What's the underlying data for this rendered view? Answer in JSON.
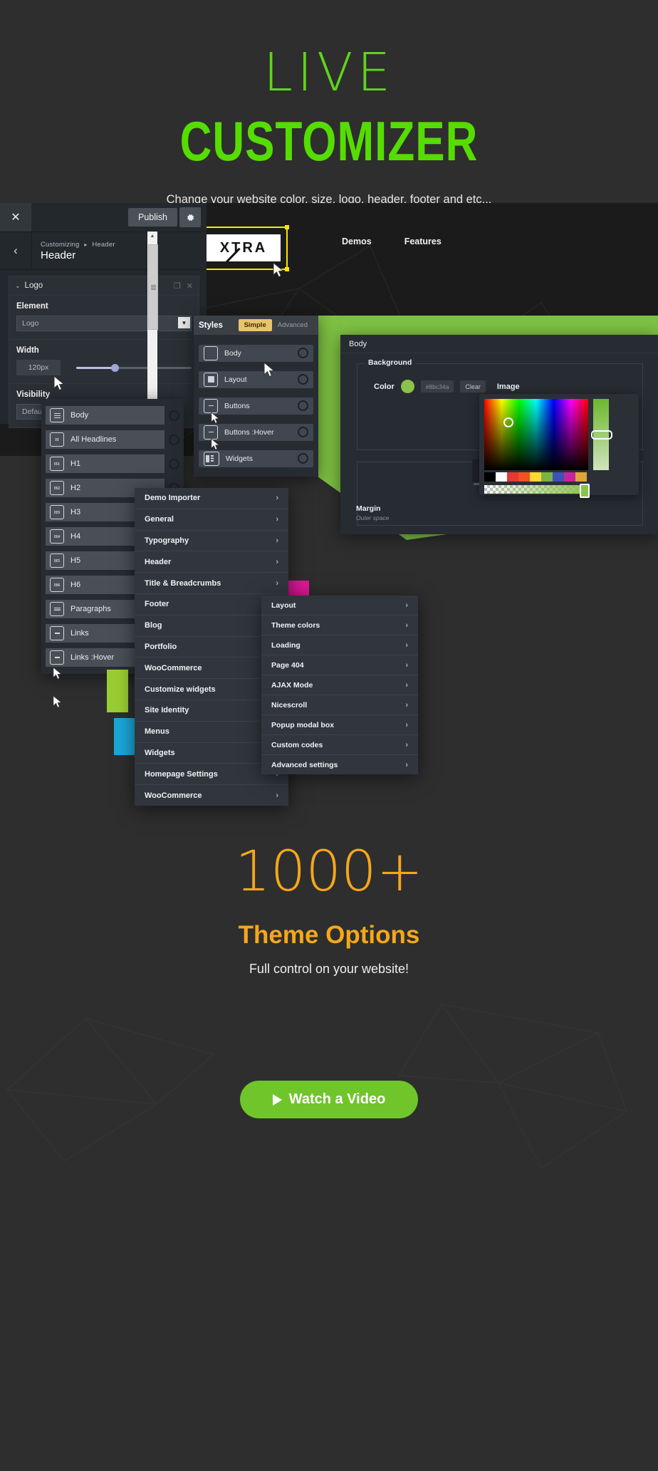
{
  "hero": {
    "line1": "LIVE",
    "line2": "CUSTOMIZER",
    "subtitle": "Change your website color, size, logo, header, footer and etc...",
    "accent_green": "#55dd00"
  },
  "customizer": {
    "close_icon": "✕",
    "publish_label": "Publish",
    "gear_icon": "✿",
    "back_icon": "‹",
    "breadcrumb_root": "Customizing",
    "breadcrumb_sep": "▸",
    "breadcrumb_current": "Header",
    "panel_title": "Header",
    "accordion": {
      "chevron": "⌄",
      "title": "Logo",
      "duplicate_icon": "❐",
      "remove_icon": "✕"
    },
    "fields": {
      "element_label": "Element",
      "element_value": "Logo",
      "element_arrow": "▼",
      "width_label": "Width",
      "width_value": "120px",
      "visibility_label": "Visibility",
      "visibility_value": "Default"
    }
  },
  "preview": {
    "logo_text": "XTRA",
    "nav": [
      "Demos",
      "Features"
    ],
    "selection_color": "#ffe500"
  },
  "typography_panel": {
    "items": [
      {
        "label": "Body",
        "icon": "text-lines-icon"
      },
      {
        "label": "All Headlines",
        "icon": "heading-icon"
      },
      {
        "label": "H1",
        "icon": "h1-icon"
      },
      {
        "label": "H2",
        "icon": "h2-icon"
      },
      {
        "label": "H3",
        "icon": "h3-icon"
      },
      {
        "label": "H4",
        "icon": "h4-icon"
      },
      {
        "label": "H5",
        "icon": "h5-icon"
      },
      {
        "label": "H6",
        "icon": "h6-icon"
      },
      {
        "label": "Paragraphs",
        "icon": "paragraph-icon"
      },
      {
        "label": "Links",
        "icon": "link-icon"
      },
      {
        "label": "Links :Hover",
        "icon": "link-hover-icon"
      }
    ]
  },
  "styles_panel": {
    "title": "Styles",
    "tab_simple": "Simple",
    "tab_advanced": "Advanced",
    "active_tab": "Simple",
    "accent": "#e9c46a",
    "items": [
      {
        "label": "Body",
        "icon": "square-outline-icon"
      },
      {
        "label": "Layout",
        "icon": "square-filled-icon"
      },
      {
        "label": "Buttons",
        "icon": "button-icon"
      },
      {
        "label": "Buttons :Hover",
        "icon": "button-hover-icon"
      },
      {
        "label": "Widgets",
        "icon": "widgets-icon"
      }
    ]
  },
  "body_panel": {
    "title": "Body",
    "background_legend": "Background",
    "color_label": "Color",
    "color_hex": "#8bc34a",
    "clear_label": "Clear",
    "image_label": "Image",
    "margin_label": "Margin",
    "margin_sub": "Outer space",
    "swatches": [
      "#000000",
      "#ffffff",
      "#e53935",
      "#f4511e",
      "#fdd835",
      "#7cb342",
      "#3f51b5",
      "#c2269a",
      "#e0a53a"
    ]
  },
  "main_menu": {
    "items": [
      "Demo Importer",
      "General",
      "Typography",
      "Header",
      "Title & Breadcrumbs",
      "Footer",
      "Blog",
      "Portfolio",
      "WooCommerce",
      "Customize widgets",
      "Site Identity",
      "Menus",
      "Widgets",
      "Homepage Settings",
      "WooCommerce"
    ],
    "chevron": "›"
  },
  "sub_menu": {
    "items": [
      "Layout",
      "Theme colors",
      "Loading",
      "Page 404",
      "AJAX Mode",
      "Nicescroll",
      "Popup modal box",
      "Custom codes",
      "Advanced settings"
    ],
    "chevron": "›"
  },
  "bottom": {
    "count": "1000+",
    "count_label": "Theme Options",
    "tagline": "Full control on your website!",
    "watch_label": "Watch a Video",
    "watch_icon": "play-icon",
    "amber": "#f5a71b",
    "green": "#6fc52a"
  }
}
